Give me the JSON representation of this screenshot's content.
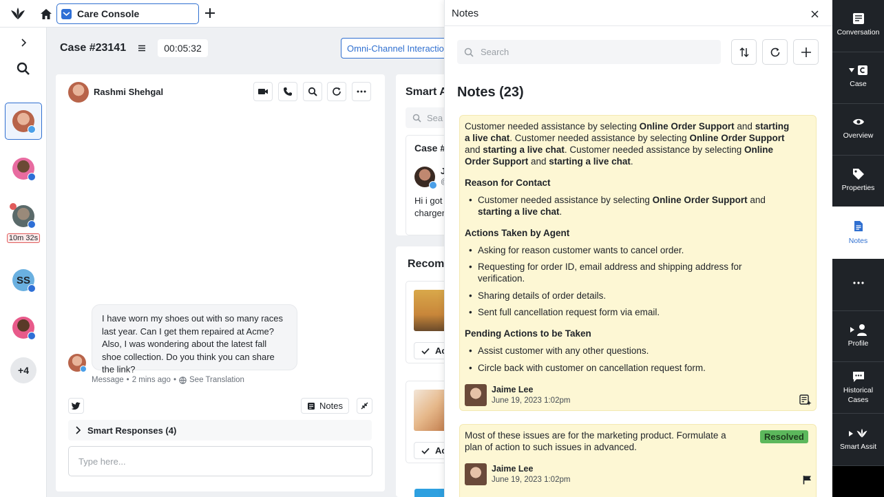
{
  "app": {
    "tab_title": "Care Console"
  },
  "case": {
    "title": "Case #23141",
    "timer": "00:05:32",
    "omni_label": "Omni-Channel Interactions"
  },
  "left_rail": {
    "timer_badge": "10m 32s",
    "initials": "SS",
    "more_count": "+4"
  },
  "conversation": {
    "customer_name": "Rashmi Shehgal",
    "message": "I have worn my shoes out with so many races last year. Can I get them repaired at Acme? Also, I was wondering about the latest fall shoe collection. Do you think you can share the link?",
    "meta_source": "Message",
    "meta_time": "2 mins ago",
    "meta_translation": "See Translation",
    "notes_button": "Notes",
    "smart_responses": "Smart Responses (4)",
    "input_placeholder": "Type here..."
  },
  "smart_assist": {
    "title": "Smart A",
    "search": "Sea",
    "case_label": "Case #",
    "card_name": "J",
    "card_handle": "@",
    "card_text_1": "Hi i got",
    "card_text_2": "charger",
    "recommended": "Recomm",
    "action_1": "Ac",
    "action_2": "Ac"
  },
  "notes_drawer": {
    "title": "Notes",
    "search_placeholder": "Search",
    "heading": "Notes (23)",
    "note1": {
      "p1_a": "Customer needed assistance by selecting ",
      "p1_b": "Online Order Support",
      "p1_c": " and ",
      "p1_d": "starting",
      "p2_a": "a live chat",
      "p2_b": ". Customer needed assistance by selecting ",
      "p2_c": "Online Order Support",
      "p3_a": "and ",
      "p3_b": "starting a live chat",
      "p3_c": ". Customer needed assistance by selecting ",
      "p3_d": "Online",
      "p4_a": "Order Support",
      "p4_b": " and ",
      "p4_c": "starting a live chat",
      "p4_d": ".",
      "reason_heading": "Reason for Contact",
      "reason_a": "Customer needed assistance by selecting ",
      "reason_b": "Online Order Support",
      "reason_c": " and",
      "reason_d": "starting a live chat",
      "reason_e": ".",
      "actions_heading": "Actions Taken by Agent",
      "actions": [
        "Asking for reason customer wants to cancel order.",
        "Requesting for order ID, email address and shipping address for",
        "verification.",
        "Sharing details of order details.",
        "Sent full cancellation request form via email."
      ],
      "pending_heading": "Pending Actions to be Taken",
      "pending": [
        "Assist customer with any other questions.",
        "Circle back with customer on cancellation request form."
      ],
      "author": "Jaime Lee",
      "date": "June 19, 2023 1:02pm"
    },
    "note2": {
      "line1": "Most of these issues are for the marketing product. Formulate a",
      "line2": "plan of action to such issues in advanced.",
      "badge": "Resolved",
      "author": "Jaime Lee",
      "date": "June 19, 2023 1:02pm"
    }
  },
  "right_rail": {
    "items": [
      "Conversation",
      "Case",
      "Overview",
      "Properties",
      "Notes",
      "Profile",
      "Historical",
      "Cases",
      "Smart Assit"
    ]
  },
  "colors": {
    "accent": "#2f6fd0",
    "note_bg": "#fdf7d4",
    "rail_bg": "#1f2328",
    "resolved": "#5cb85c"
  }
}
